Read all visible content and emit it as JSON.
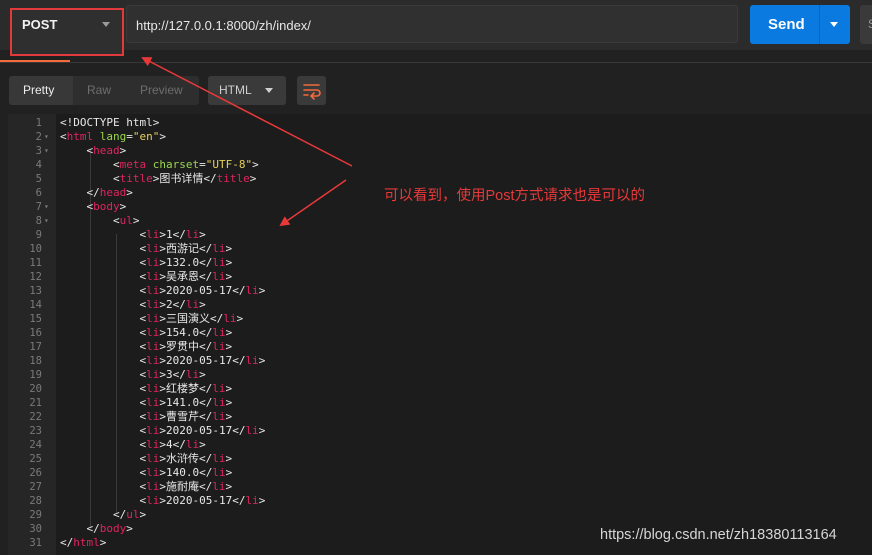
{
  "request": {
    "method": "POST",
    "url": "http://127.0.0.1:8000/zh/index/",
    "send_label": "Send",
    "save_initial": "S"
  },
  "response_toolbar": {
    "tabs": [
      "Pretty",
      "Raw",
      "Preview"
    ],
    "language": "HTML",
    "wrap_icon": "wrap-lines-icon"
  },
  "code_lines": [
    [
      [
        "t",
        "<!DOCTYPE html>"
      ]
    ],
    [
      [
        "g",
        "<"
      ],
      [
        "k",
        "html"
      ],
      [
        "t",
        " "
      ],
      [
        "a",
        "lang"
      ],
      [
        "t",
        "="
      ],
      [
        "s",
        "\"en\""
      ],
      [
        "t",
        ">"
      ]
    ],
    [
      [
        "t",
        "    <"
      ],
      [
        "k",
        "head"
      ],
      [
        "t",
        ">"
      ]
    ],
    [
      [
        "t",
        "        <"
      ],
      [
        "k",
        "meta"
      ],
      [
        "t",
        " "
      ],
      [
        "a",
        "charset"
      ],
      [
        "t",
        "="
      ],
      [
        "s",
        "\"UTF-8\""
      ],
      [
        "t",
        ">"
      ]
    ],
    [
      [
        "t",
        "        <"
      ],
      [
        "k",
        "title"
      ],
      [
        "t",
        ">图书详情</"
      ],
      [
        "k",
        "title"
      ],
      [
        "t",
        ">"
      ]
    ],
    [
      [
        "t",
        "    </"
      ],
      [
        "k",
        "head"
      ],
      [
        "t",
        ">"
      ]
    ],
    [
      [
        "t",
        "    <"
      ],
      [
        "k",
        "body"
      ],
      [
        "t",
        ">"
      ]
    ],
    [
      [
        "t",
        "        <"
      ],
      [
        "k",
        "ul"
      ],
      [
        "t",
        ">"
      ]
    ],
    [
      [
        "t",
        "            <"
      ],
      [
        "k",
        "li"
      ],
      [
        "t",
        ">1</"
      ],
      [
        "k",
        "li"
      ],
      [
        "t",
        ">"
      ]
    ],
    [
      [
        "t",
        "            <"
      ],
      [
        "k",
        "li"
      ],
      [
        "t",
        ">西游记</"
      ],
      [
        "k",
        "li"
      ],
      [
        "t",
        ">"
      ]
    ],
    [
      [
        "t",
        "            <"
      ],
      [
        "k",
        "li"
      ],
      [
        "t",
        ">132.0</"
      ],
      [
        "k",
        "li"
      ],
      [
        "t",
        ">"
      ]
    ],
    [
      [
        "t",
        "            <"
      ],
      [
        "k",
        "li"
      ],
      [
        "t",
        ">吴承恩</"
      ],
      [
        "k",
        "li"
      ],
      [
        "t",
        ">"
      ]
    ],
    [
      [
        "t",
        "            <"
      ],
      [
        "k",
        "li"
      ],
      [
        "t",
        ">2020-05-17</"
      ],
      [
        "k",
        "li"
      ],
      [
        "t",
        ">"
      ]
    ],
    [
      [
        "t",
        "            <"
      ],
      [
        "k",
        "li"
      ],
      [
        "t",
        ">2</"
      ],
      [
        "k",
        "li"
      ],
      [
        "t",
        ">"
      ]
    ],
    [
      [
        "t",
        "            <"
      ],
      [
        "k",
        "li"
      ],
      [
        "t",
        ">三国演义</"
      ],
      [
        "k",
        "li"
      ],
      [
        "t",
        ">"
      ]
    ],
    [
      [
        "t",
        "            <"
      ],
      [
        "k",
        "li"
      ],
      [
        "t",
        ">154.0</"
      ],
      [
        "k",
        "li"
      ],
      [
        "t",
        ">"
      ]
    ],
    [
      [
        "t",
        "            <"
      ],
      [
        "k",
        "li"
      ],
      [
        "t",
        ">罗贯中</"
      ],
      [
        "k",
        "li"
      ],
      [
        "t",
        ">"
      ]
    ],
    [
      [
        "t",
        "            <"
      ],
      [
        "k",
        "li"
      ],
      [
        "t",
        ">2020-05-17</"
      ],
      [
        "k",
        "li"
      ],
      [
        "t",
        ">"
      ]
    ],
    [
      [
        "t",
        "            <"
      ],
      [
        "k",
        "li"
      ],
      [
        "t",
        ">3</"
      ],
      [
        "k",
        "li"
      ],
      [
        "t",
        ">"
      ]
    ],
    [
      [
        "t",
        "            <"
      ],
      [
        "k",
        "li"
      ],
      [
        "t",
        ">红楼梦</"
      ],
      [
        "k",
        "li"
      ],
      [
        "t",
        ">"
      ]
    ],
    [
      [
        "t",
        "            <"
      ],
      [
        "k",
        "li"
      ],
      [
        "t",
        ">141.0</"
      ],
      [
        "k",
        "li"
      ],
      [
        "t",
        ">"
      ]
    ],
    [
      [
        "t",
        "            <"
      ],
      [
        "k",
        "li"
      ],
      [
        "t",
        ">曹雪芹</"
      ],
      [
        "k",
        "li"
      ],
      [
        "t",
        ">"
      ]
    ],
    [
      [
        "t",
        "            <"
      ],
      [
        "k",
        "li"
      ],
      [
        "t",
        ">2020-05-17</"
      ],
      [
        "k",
        "li"
      ],
      [
        "t",
        ">"
      ]
    ],
    [
      [
        "t",
        "            <"
      ],
      [
        "k",
        "li"
      ],
      [
        "t",
        ">4</"
      ],
      [
        "k",
        "li"
      ],
      [
        "t",
        ">"
      ]
    ],
    [
      [
        "t",
        "            <"
      ],
      [
        "k",
        "li"
      ],
      [
        "t",
        ">水浒传</"
      ],
      [
        "k",
        "li"
      ],
      [
        "t",
        ">"
      ]
    ],
    [
      [
        "t",
        "            <"
      ],
      [
        "k",
        "li"
      ],
      [
        "t",
        ">140.0</"
      ],
      [
        "k",
        "li"
      ],
      [
        "t",
        ">"
      ]
    ],
    [
      [
        "t",
        "            <"
      ],
      [
        "k",
        "li"
      ],
      [
        "t",
        ">施耐庵</"
      ],
      [
        "k",
        "li"
      ],
      [
        "t",
        ">"
      ]
    ],
    [
      [
        "t",
        "            <"
      ],
      [
        "k",
        "li"
      ],
      [
        "t",
        ">2020-05-17</"
      ],
      [
        "k",
        "li"
      ],
      [
        "t",
        ">"
      ]
    ],
    [
      [
        "t",
        "        </"
      ],
      [
        "k",
        "ul"
      ],
      [
        "t",
        ">"
      ]
    ],
    [
      [
        "t",
        "    </"
      ],
      [
        "k",
        "body"
      ],
      [
        "t",
        ">"
      ]
    ],
    [
      [
        "t",
        "</"
      ],
      [
        "k",
        "html"
      ],
      [
        "t",
        ">"
      ]
    ]
  ],
  "folded_lines": [
    2,
    3,
    7,
    8
  ],
  "annotation_text": "可以看到，使用Post方式请求也是可以的",
  "watermark": "https://blog.csdn.net/zh18380113164",
  "colors": {
    "accent_blue": "#0b7ae0",
    "highlight_red": "#e23a3a",
    "tab_underline": "#f26b3a",
    "tag_pink": "#e0245e",
    "attr_green": "#9bd64e",
    "string_yellow": "#e5d05a"
  }
}
